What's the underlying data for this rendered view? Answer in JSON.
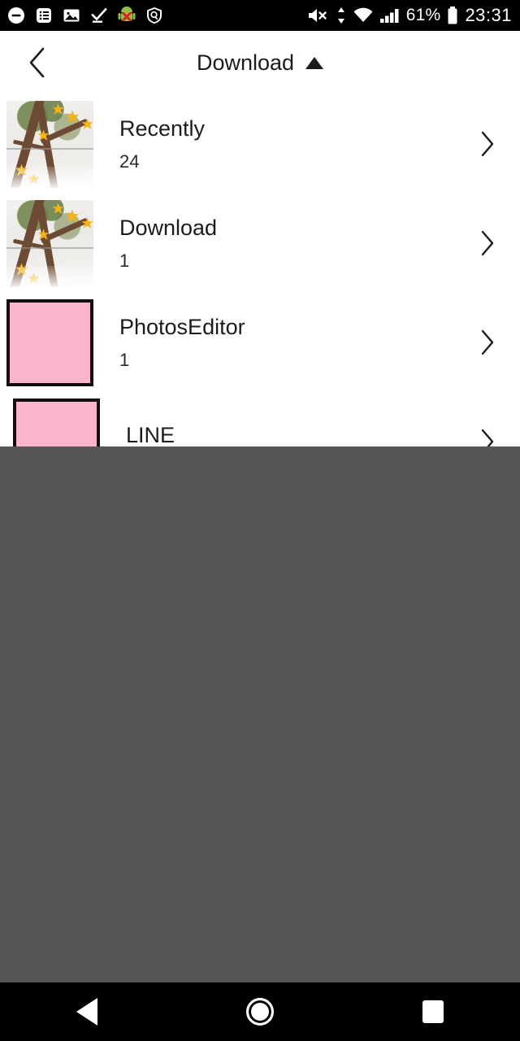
{
  "statusbar": {
    "left_icons": [
      {
        "name": "do-not-disturb-icon",
        "glyph": "minus-circle"
      },
      {
        "name": "notes-list-icon",
        "glyph": "list"
      },
      {
        "name": "gallery-image-icon",
        "glyph": "photo"
      },
      {
        "name": "check-underline-icon",
        "glyph": "check"
      },
      {
        "name": "android-error-icon",
        "glyph": "android"
      },
      {
        "name": "shield-scan-icon",
        "glyph": "shield"
      }
    ],
    "volume_mute": "mute",
    "data_transfer": "up-down-arrows",
    "wifi": "wifi-full",
    "signal": "signal-full",
    "battery_percent": "61%",
    "battery": "battery-icon",
    "clock": "23:31"
  },
  "header": {
    "back_label": "back",
    "title": "Download",
    "dropdown_indicator": "caret-up"
  },
  "list": {
    "items": [
      {
        "title": "Recently",
        "count": "24",
        "thumb": "photo",
        "chevron": "chevron-right"
      },
      {
        "title": "Download",
        "count": "1",
        "thumb": "photo",
        "chevron": "chevron-right"
      },
      {
        "title": "PhotosEditor",
        "count": "1",
        "thumb": "pink",
        "chevron": "chevron-right"
      },
      {
        "title": "LINE",
        "count": "",
        "thumb": "pink",
        "chevron": "chevron-right"
      }
    ]
  },
  "navbar": {
    "back_label": "Back",
    "home_label": "Home",
    "recents_label": "Recents"
  },
  "colors": {
    "status_bar_bg": "#000000",
    "page_bg": "#ffffff",
    "text_primary": "#1c1c1c",
    "overlay": "#565656",
    "thumb_pink": "#fbb4cd",
    "nav_bg": "#000000"
  }
}
